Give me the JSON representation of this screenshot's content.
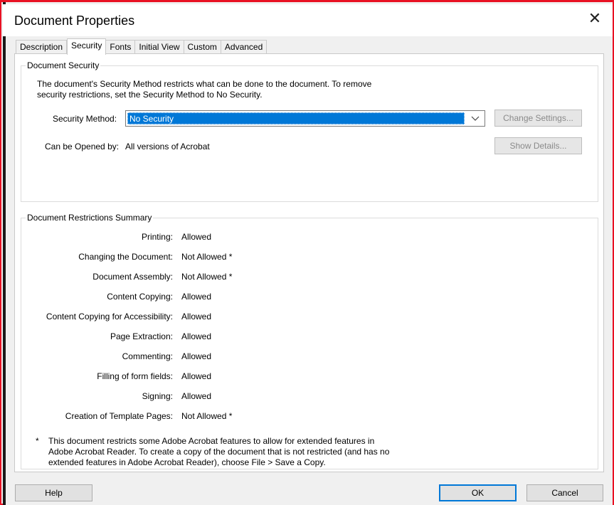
{
  "window": {
    "title": "Document Properties",
    "close_glyph": "✕"
  },
  "tabs": [
    {
      "label": "Description",
      "active": false
    },
    {
      "label": "Security",
      "active": true
    },
    {
      "label": "Fonts",
      "active": false
    },
    {
      "label": "Initial View",
      "active": false
    },
    {
      "label": "Custom",
      "active": false
    },
    {
      "label": "Advanced",
      "active": false
    }
  ],
  "security": {
    "group_title": "Document Security",
    "description": "The document's Security Method restricts what can be done to the document. To remove security restrictions, set the Security Method to No Security.",
    "method_label": "Security Method:",
    "method_value": "No Security",
    "change_settings_label": "Change Settings...",
    "opened_by_label": "Can be Opened by:",
    "opened_by_value": "All versions of Acrobat",
    "show_details_label": "Show Details..."
  },
  "restrictions": {
    "group_title": "Document Restrictions Summary",
    "rows": [
      {
        "label": "Printing:",
        "value": "Allowed"
      },
      {
        "label": "Changing the Document:",
        "value": "Not Allowed *"
      },
      {
        "label": "Document Assembly:",
        "value": "Not Allowed *"
      },
      {
        "label": "Content Copying:",
        "value": "Allowed"
      },
      {
        "label": "Content Copying for Accessibility:",
        "value": "Allowed"
      },
      {
        "label": "Page Extraction:",
        "value": "Allowed"
      },
      {
        "label": "Commenting:",
        "value": "Allowed"
      },
      {
        "label": "Filling of form fields:",
        "value": "Allowed"
      },
      {
        "label": "Signing:",
        "value": "Allowed"
      },
      {
        "label": "Creation of Template Pages:",
        "value": "Not Allowed *"
      }
    ],
    "note_marker": "*",
    "note": "This document restricts some Adobe Acrobat features to allow for extended features in Adobe Acrobat Reader. To create a copy of the document that is not restricted (and has no extended features in Adobe Acrobat Reader), choose File > Save a Copy."
  },
  "footer": {
    "help_label": "Help",
    "ok_label": "OK",
    "cancel_label": "Cancel"
  },
  "colors": {
    "accent": "#0078d7",
    "frame_border": "#e81123"
  }
}
